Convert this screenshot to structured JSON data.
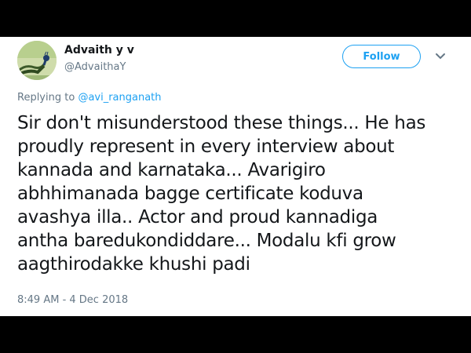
{
  "author": {
    "display_name": "Advaith y v",
    "handle": "@AdvaithaY",
    "avatar_icon": "peacock-avatar"
  },
  "follow_button": {
    "label": "Follow"
  },
  "more_menu": {
    "icon": "chevron-down-icon"
  },
  "reply": {
    "prefix": "Replying to",
    "mention": "@avi_ranganath"
  },
  "tweet": {
    "lines": [
      "Sir don't misunderstood these things... He has",
      "proudly represent in every interview about",
      "kannada and karnataka... Avarigiro",
      "abhhimanada bagge certificate koduva",
      "avashya illa.. Actor and proud kannadiga",
      "antha baredukondiddare... Modalu kfi grow",
      "aagthirodakke khushi padi"
    ],
    "timestamp": "8:49 AM - 4 Dec 2018"
  },
  "colors": {
    "accent": "#1da1f2",
    "secondary_text": "#657786",
    "primary_text": "#14171a",
    "letterbox": "#000000"
  }
}
